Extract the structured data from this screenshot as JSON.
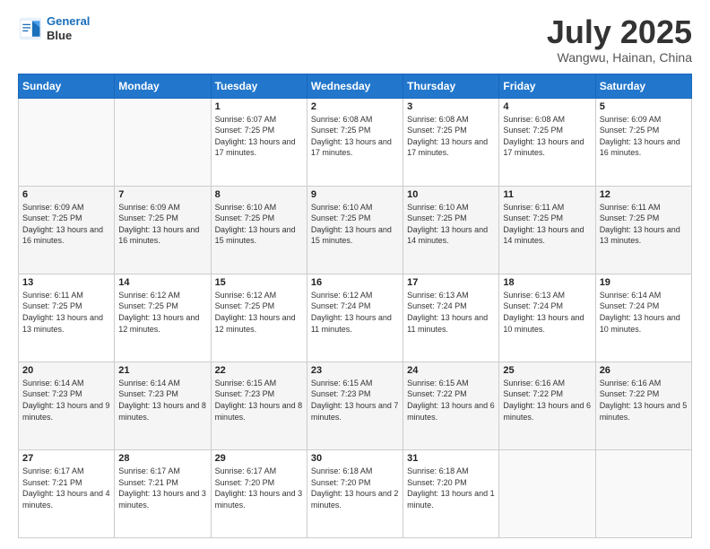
{
  "header": {
    "logo_line1": "General",
    "logo_line2": "Blue",
    "month": "July 2025",
    "location": "Wangwu, Hainan, China"
  },
  "weekdays": [
    "Sunday",
    "Monday",
    "Tuesday",
    "Wednesday",
    "Thursday",
    "Friday",
    "Saturday"
  ],
  "weeks": [
    [
      {
        "day": "",
        "info": ""
      },
      {
        "day": "",
        "info": ""
      },
      {
        "day": "1",
        "info": "Sunrise: 6:07 AM\nSunset: 7:25 PM\nDaylight: 13 hours and 17 minutes."
      },
      {
        "day": "2",
        "info": "Sunrise: 6:08 AM\nSunset: 7:25 PM\nDaylight: 13 hours and 17 minutes."
      },
      {
        "day": "3",
        "info": "Sunrise: 6:08 AM\nSunset: 7:25 PM\nDaylight: 13 hours and 17 minutes."
      },
      {
        "day": "4",
        "info": "Sunrise: 6:08 AM\nSunset: 7:25 PM\nDaylight: 13 hours and 17 minutes."
      },
      {
        "day": "5",
        "info": "Sunrise: 6:09 AM\nSunset: 7:25 PM\nDaylight: 13 hours and 16 minutes."
      }
    ],
    [
      {
        "day": "6",
        "info": "Sunrise: 6:09 AM\nSunset: 7:25 PM\nDaylight: 13 hours and 16 minutes."
      },
      {
        "day": "7",
        "info": "Sunrise: 6:09 AM\nSunset: 7:25 PM\nDaylight: 13 hours and 16 minutes."
      },
      {
        "day": "8",
        "info": "Sunrise: 6:10 AM\nSunset: 7:25 PM\nDaylight: 13 hours and 15 minutes."
      },
      {
        "day": "9",
        "info": "Sunrise: 6:10 AM\nSunset: 7:25 PM\nDaylight: 13 hours and 15 minutes."
      },
      {
        "day": "10",
        "info": "Sunrise: 6:10 AM\nSunset: 7:25 PM\nDaylight: 13 hours and 14 minutes."
      },
      {
        "day": "11",
        "info": "Sunrise: 6:11 AM\nSunset: 7:25 PM\nDaylight: 13 hours and 14 minutes."
      },
      {
        "day": "12",
        "info": "Sunrise: 6:11 AM\nSunset: 7:25 PM\nDaylight: 13 hours and 13 minutes."
      }
    ],
    [
      {
        "day": "13",
        "info": "Sunrise: 6:11 AM\nSunset: 7:25 PM\nDaylight: 13 hours and 13 minutes."
      },
      {
        "day": "14",
        "info": "Sunrise: 6:12 AM\nSunset: 7:25 PM\nDaylight: 13 hours and 12 minutes."
      },
      {
        "day": "15",
        "info": "Sunrise: 6:12 AM\nSunset: 7:25 PM\nDaylight: 13 hours and 12 minutes."
      },
      {
        "day": "16",
        "info": "Sunrise: 6:12 AM\nSunset: 7:24 PM\nDaylight: 13 hours and 11 minutes."
      },
      {
        "day": "17",
        "info": "Sunrise: 6:13 AM\nSunset: 7:24 PM\nDaylight: 13 hours and 11 minutes."
      },
      {
        "day": "18",
        "info": "Sunrise: 6:13 AM\nSunset: 7:24 PM\nDaylight: 13 hours and 10 minutes."
      },
      {
        "day": "19",
        "info": "Sunrise: 6:14 AM\nSunset: 7:24 PM\nDaylight: 13 hours and 10 minutes."
      }
    ],
    [
      {
        "day": "20",
        "info": "Sunrise: 6:14 AM\nSunset: 7:23 PM\nDaylight: 13 hours and 9 minutes."
      },
      {
        "day": "21",
        "info": "Sunrise: 6:14 AM\nSunset: 7:23 PM\nDaylight: 13 hours and 8 minutes."
      },
      {
        "day": "22",
        "info": "Sunrise: 6:15 AM\nSunset: 7:23 PM\nDaylight: 13 hours and 8 minutes."
      },
      {
        "day": "23",
        "info": "Sunrise: 6:15 AM\nSunset: 7:23 PM\nDaylight: 13 hours and 7 minutes."
      },
      {
        "day": "24",
        "info": "Sunrise: 6:15 AM\nSunset: 7:22 PM\nDaylight: 13 hours and 6 minutes."
      },
      {
        "day": "25",
        "info": "Sunrise: 6:16 AM\nSunset: 7:22 PM\nDaylight: 13 hours and 6 minutes."
      },
      {
        "day": "26",
        "info": "Sunrise: 6:16 AM\nSunset: 7:22 PM\nDaylight: 13 hours and 5 minutes."
      }
    ],
    [
      {
        "day": "27",
        "info": "Sunrise: 6:17 AM\nSunset: 7:21 PM\nDaylight: 13 hours and 4 minutes."
      },
      {
        "day": "28",
        "info": "Sunrise: 6:17 AM\nSunset: 7:21 PM\nDaylight: 13 hours and 3 minutes."
      },
      {
        "day": "29",
        "info": "Sunrise: 6:17 AM\nSunset: 7:20 PM\nDaylight: 13 hours and 3 minutes."
      },
      {
        "day": "30",
        "info": "Sunrise: 6:18 AM\nSunset: 7:20 PM\nDaylight: 13 hours and 2 minutes."
      },
      {
        "day": "31",
        "info": "Sunrise: 6:18 AM\nSunset: 7:20 PM\nDaylight: 13 hours and 1 minute."
      },
      {
        "day": "",
        "info": ""
      },
      {
        "day": "",
        "info": ""
      }
    ]
  ]
}
